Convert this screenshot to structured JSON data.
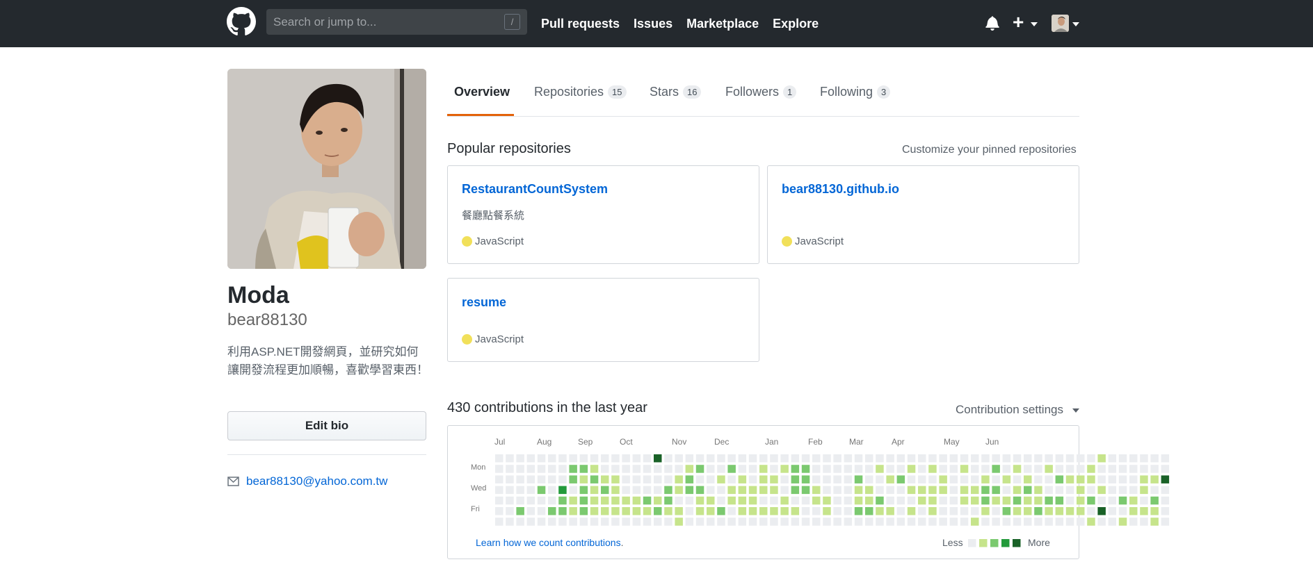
{
  "header": {
    "search_placeholder": "Search or jump to...",
    "search_shortcut": "/",
    "nav": [
      "Pull requests",
      "Issues",
      "Marketplace",
      "Explore"
    ],
    "plus_glyph": "+"
  },
  "profile": {
    "name": "Moda",
    "login": "bear88130",
    "bio": "利用ASP.NET開發網頁，並研究如何讓開發流程更加順暢，喜歡學習東西！",
    "edit_bio_label": "Edit bio",
    "email": "bear88130@yahoo.com.tw"
  },
  "tabs": [
    {
      "label": "Overview",
      "count": null,
      "active": true
    },
    {
      "label": "Repositories",
      "count": "15",
      "active": false
    },
    {
      "label": "Stars",
      "count": "16",
      "active": false
    },
    {
      "label": "Followers",
      "count": "1",
      "active": false
    },
    {
      "label": "Following",
      "count": "3",
      "active": false
    }
  ],
  "popular": {
    "title": "Popular repositories",
    "customize_link": "Customize your pinned repositories",
    "repos": [
      {
        "name": "RestaurantCountSystem",
        "description": "餐廳點餐系統",
        "language": "JavaScript"
      },
      {
        "name": "bear88130.github.io",
        "description": "",
        "language": "JavaScript"
      },
      {
        "name": "resume",
        "description": "",
        "language": "JavaScript"
      }
    ],
    "language_color": "#f1e05a"
  },
  "contributions": {
    "title": "430 contributions in the last year",
    "settings_label": "Contribution settings",
    "months": [
      "Jul",
      "Aug",
      "Sep",
      "Oct",
      "Nov",
      "Dec",
      "Jan",
      "Feb",
      "Mar",
      "Apr",
      "May",
      "Jun"
    ],
    "days": [
      "Mon",
      "Wed",
      "Fri"
    ],
    "learn_link": "Learn how we count contributions",
    "learn_suffix": ".",
    "legend_less": "Less",
    "legend_more": "More",
    "colors": [
      "#ebedf0",
      "#c6e48b",
      "#7bc96f",
      "#239a3b",
      "#196127"
    ],
    "grid": [
      "0000000",
      "0000000",
      "0000020",
      "0000000",
      "0002000",
      "0000020",
      "0003220",
      "0220110",
      "0212220",
      "0121110",
      "0012110",
      "0011110",
      "0000110",
      "0000110",
      "0000210",
      "4000120",
      "0002210",
      "0011011",
      "0122000",
      "0202110",
      "0000110",
      "0010020",
      "0201100",
      "0011110",
      "0001110",
      "0111010",
      "0011010",
      "0100110",
      "0222010",
      "0222000",
      "0001100",
      "0000110",
      "0000000",
      "0000000",
      "0021120",
      "0001120",
      "0100210",
      "0010010",
      "0020000",
      "0101010",
      "0001100",
      "0101110",
      "0011000",
      "0000000",
      "0101100",
      "0001101",
      "0012210",
      "0202100",
      "0010120",
      "0101210",
      "0012110",
      "0001120",
      "0100210",
      "0020210",
      "0010010",
      "0011110",
      "0110201",
      "1001040",
      "0000000",
      "0000201",
      "0000110",
      "0011010",
      "0010211",
      "0040000"
    ]
  }
}
